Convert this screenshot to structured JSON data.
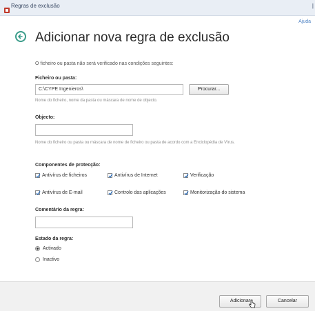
{
  "window": {
    "title": "Regras de exclusão",
    "corner": "|"
  },
  "help_label": "Ajuda",
  "page_title": "Adicionar nova regra de exclusão",
  "intro": "O ficheiro ou pasta não será verificado nas condições seguintes:",
  "file_field": {
    "label": "Ficheiro ou pasta:",
    "value": "C:\\CYPE Ingenieros\\",
    "browse_label": "Procurar...",
    "hint": "Nome do ficheiro, nome da pasta ou máscara de nome de objecto."
  },
  "object_field": {
    "label": "Objecto:",
    "value": "",
    "hint": "Nome do ficheiro ou pasta ou máscara de nome de ficheiro ou pasta de acordo com a Enciclopédia de Vírus."
  },
  "components": {
    "label": "Componentes de protecção:",
    "items": [
      {
        "label": "Antivírus de ficheiros",
        "checked": true
      },
      {
        "label": "Antivírus de Internet",
        "checked": true
      },
      {
        "label": "Verificação",
        "checked": true
      },
      {
        "label": "Antivírus de E-mail",
        "checked": true
      },
      {
        "label": "Controlo das aplicações",
        "checked": true
      },
      {
        "label": "Monitorização do sistema",
        "checked": true
      }
    ]
  },
  "comment_field": {
    "label": "Comentário da regra:",
    "value": ""
  },
  "status": {
    "label": "Estado da regra:",
    "options": [
      {
        "label": "Activado",
        "selected": true
      },
      {
        "label": "Inactivo",
        "selected": false
      }
    ]
  },
  "buttons": {
    "add": "Adicionar",
    "cancel": "Cancelar"
  },
  "colors": {
    "accent": "#3a9c8a",
    "link": "#4f83c4",
    "titlebar": "#e9eef5"
  },
  "icons": {
    "back": "back-arrow-icon",
    "check": "check-icon",
    "cursor": "pointer-cursor-icon"
  }
}
